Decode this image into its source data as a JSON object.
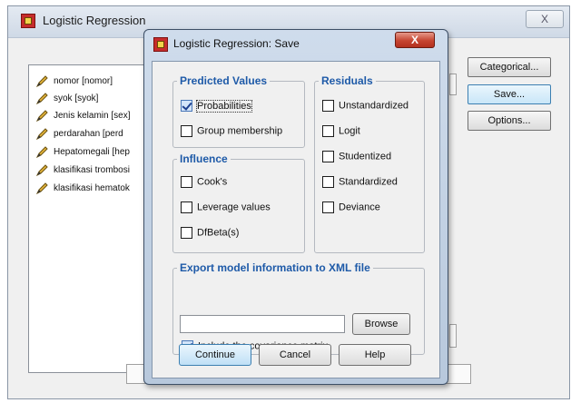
{
  "main_window": {
    "title": "Logistic Regression",
    "close_glyph": "X",
    "variables": [
      {
        "label": "nomor [nomor]",
        "icon": "ruler-pencil-icon"
      },
      {
        "label": "syok [syok]",
        "icon": "ruler-pencil-icon"
      },
      {
        "label": "Jenis kelamin [sex]",
        "icon": "ruler-pencil-icon"
      },
      {
        "label": "perdarahan [perd",
        "icon": "ruler-pencil-icon"
      },
      {
        "label": "Hepatomegali [hep",
        "icon": "ruler-pencil-icon"
      },
      {
        "label": "klasifikasi trombosi",
        "icon": "ruler-pencil-icon"
      },
      {
        "label": "klasifikasi hematok",
        "icon": "ruler-pencil-icon"
      }
    ],
    "side_buttons": {
      "categorical": "Categorical...",
      "save": "Save...",
      "options": "Options..."
    }
  },
  "dialog": {
    "title": "Logistic Regression: Save",
    "close_glyph": "X",
    "predicted_values": {
      "title": "Predicted Values",
      "probabilities": {
        "label": "Probabilities",
        "checked": true
      },
      "group_membership": {
        "label": "Group membership",
        "checked": false
      }
    },
    "influence": {
      "title": "Influence",
      "cooks": {
        "label": "Cook's",
        "checked": false
      },
      "leverage": {
        "label": "Leverage values",
        "checked": false
      },
      "dfbeta": {
        "label": "DfBeta(s)",
        "checked": false
      }
    },
    "residuals": {
      "title": "Residuals",
      "unstandardized": {
        "label": "Unstandardized",
        "checked": false
      },
      "logit": {
        "label": "Logit",
        "checked": false
      },
      "studentized": {
        "label": "Studentized",
        "checked": false
      },
      "standardized": {
        "label": "Standardized",
        "checked": false
      },
      "deviance": {
        "label": "Deviance",
        "checked": false
      }
    },
    "export": {
      "title": "Export model information to XML file",
      "path_value": "",
      "browse_label": "Browse",
      "include_covariance": {
        "label": "Include the covariance matrix",
        "checked": true
      }
    },
    "buttons": {
      "continue": "Continue",
      "cancel": "Cancel",
      "help": "Help"
    }
  },
  "colors": {
    "group_title": "#1e5aa8",
    "close_button": "#c64531",
    "dialog_frame": "#b7c8dc"
  }
}
